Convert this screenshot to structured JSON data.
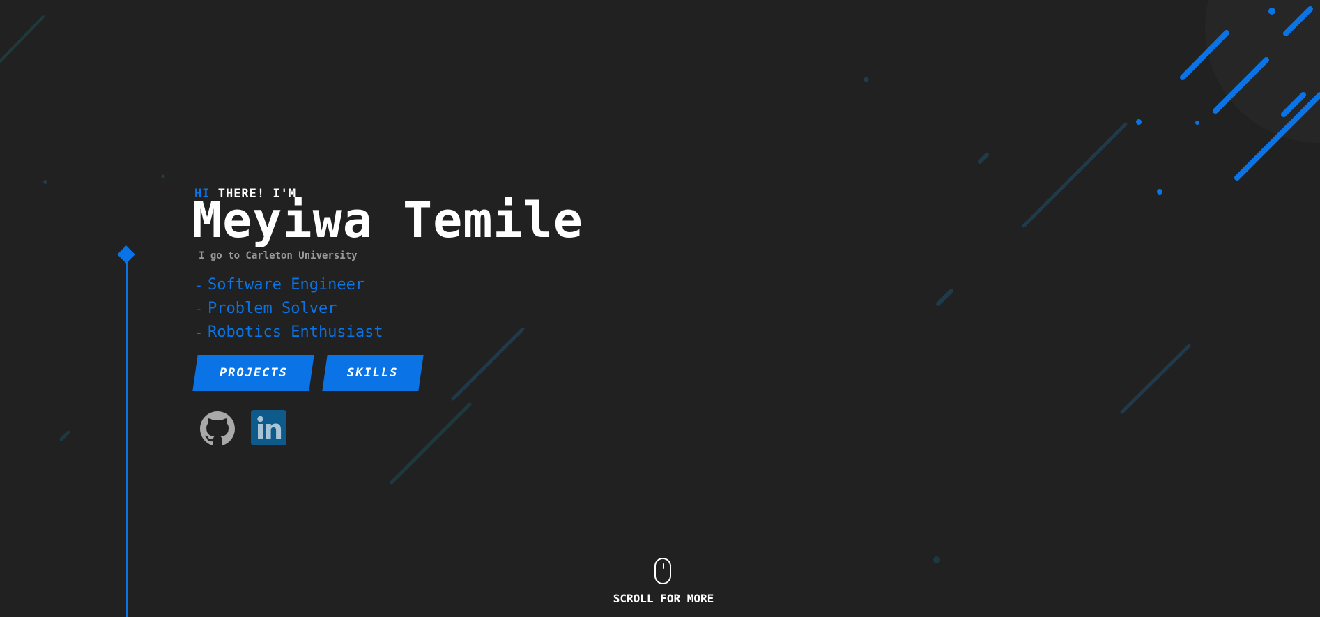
{
  "hero": {
    "greeting_highlight": "HI",
    "greeting_rest": " THERE! I'M",
    "name": "Meyiwa Temile",
    "school": "I go to Carleton University",
    "roles": [
      {
        "dash": "-",
        "label": "Software Engineer"
      },
      {
        "dash": "-",
        "label": "Problem Solver"
      },
      {
        "dash": "-",
        "label": "Robotics Enthusiast"
      }
    ],
    "buttons": {
      "projects_label": "PROJECTS",
      "skills_label": "SKILLS"
    },
    "social": {
      "github_icon": "github-icon",
      "linkedin_icon": "linkedin-icon"
    }
  },
  "scroll": {
    "label": "SCROLL FOR MORE",
    "icon": "mouse-icon"
  },
  "theme": {
    "background": "#212121",
    "accent": "#0a74e6",
    "muted_text": "#9a9a9a",
    "linkedin_bg": "#0e5a8a"
  }
}
